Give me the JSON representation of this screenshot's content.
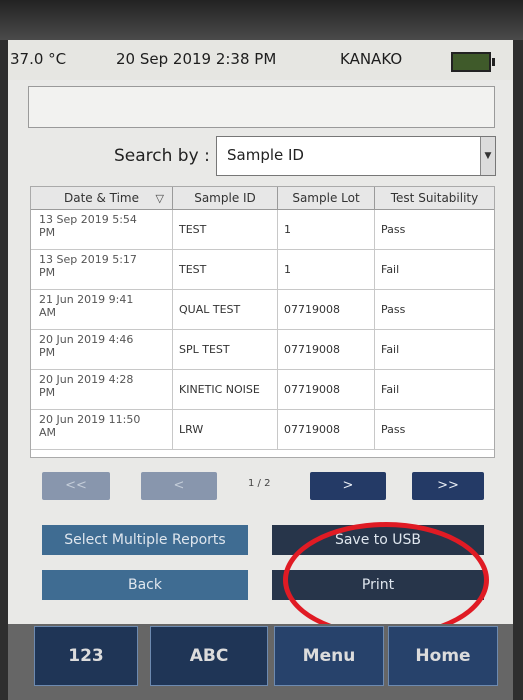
{
  "status": {
    "temperature": "37.0 °C",
    "datetime": "20 Sep 2019 2:38 PM",
    "user": "KANAKO"
  },
  "search": {
    "label": "Search by :",
    "value": "Sample ID"
  },
  "table": {
    "headers": [
      "Date & Time",
      "Sample ID",
      "Sample Lot",
      "Test Suitability"
    ],
    "rows": [
      {
        "date": "13 Sep 2019 5:54",
        "date2": "PM",
        "id": "TEST",
        "lot": "1",
        "result": "Pass"
      },
      {
        "date": "13 Sep 2019 5:17",
        "date2": "PM",
        "id": "TEST",
        "lot": "1",
        "result": "Fail"
      },
      {
        "date": "21 Jun 2019 9:41",
        "date2": "AM",
        "id": "QUAL TEST",
        "lot": "07719008",
        "result": "Pass"
      },
      {
        "date": "20 Jun 2019 4:46",
        "date2": "PM",
        "id": "SPL TEST",
        "lot": "07719008",
        "result": "Fail"
      },
      {
        "date": "20 Jun 2019 4:28",
        "date2": "PM",
        "id": "KINETIC NOISE",
        "lot": "07719008",
        "result": "Fail"
      },
      {
        "date": "20 Jun 2019 11:50",
        "date2": "AM",
        "id": "LRW",
        "lot": "07719008",
        "result": "Pass"
      }
    ]
  },
  "pager": {
    "first": "<<",
    "prev": "<",
    "page": "1 / 2",
    "next": ">",
    "last": ">>"
  },
  "actions": {
    "select_multiple": "Select Multiple Reports",
    "save_usb": "Save to USB",
    "back": "Back",
    "print": "Print"
  },
  "nav": {
    "num": "123",
    "abc": "ABC",
    "menu": "Menu",
    "home": "Home"
  },
  "colors": {
    "highlight_circle": "#e01b24",
    "button_blue": "#3f6c92",
    "button_dark": "#27354a",
    "nav_bg": "#1f3556"
  }
}
